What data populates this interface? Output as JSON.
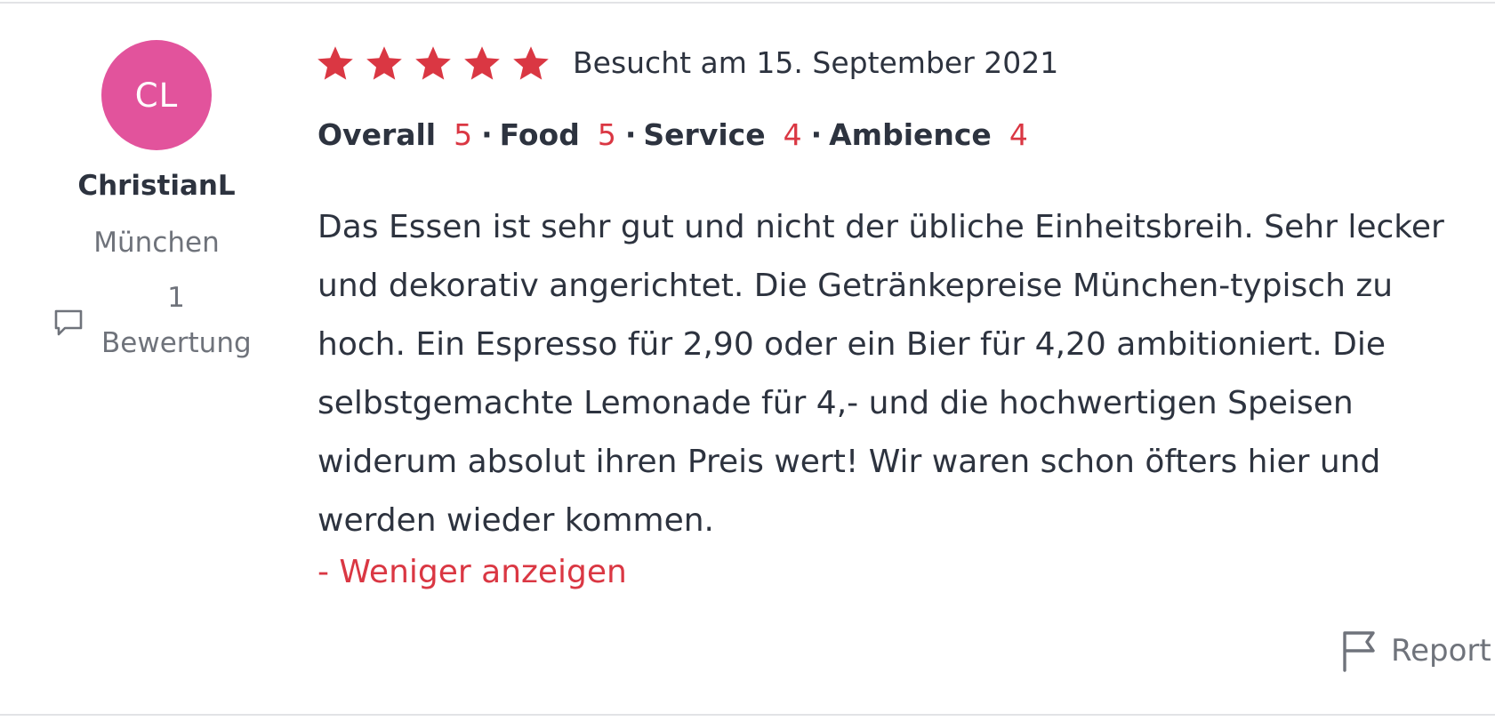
{
  "reviewer": {
    "initials": "CL",
    "avatar_color": "#e2539c",
    "name": "ChristianL",
    "location": "München",
    "review_count": "1",
    "review_count_label": "Bewertung",
    "review_count_icon": "speech-bubble-icon"
  },
  "review": {
    "stars": 5,
    "star_color": "#da3743",
    "visited": "Besucht am 15. September 2021",
    "ratings": [
      {
        "label": "Overall",
        "value": "5"
      },
      {
        "label": "Food",
        "value": "5"
      },
      {
        "label": "Service",
        "value": "4"
      },
      {
        "label": "Ambience",
        "value": "4"
      }
    ],
    "separator": "·",
    "lines": [
      "Das Essen ist sehr gut und nicht der übliche Einheitsbreih. Sehr lecker",
      "und dekorativ angerichtet. Die Getränkepreise München-typisch zu",
      "hoch. Ein Espresso für 2,90 oder ein Bier für 4,20 ambitioniert. Die",
      "selbstgemachte Lemonade für 4,- und die hochwertigen Speisen",
      "widerum absolut ihren Preis wert! Wir waren schon öfters hier und",
      "werden wieder kommen."
    ],
    "show_less_label": "- Weniger anzeigen"
  },
  "report": {
    "label": "Report",
    "icon": "flag-icon"
  },
  "colors": {
    "accent": "#da3743",
    "text": "#2d333f",
    "muted": "#6f737b",
    "rule": "#e2e3e6"
  }
}
